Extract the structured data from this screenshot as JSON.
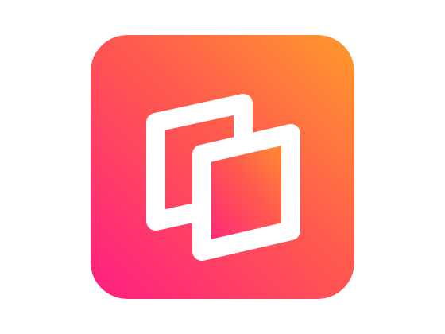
{
  "app_icon": {
    "icon": "overlapping-squares-icon",
    "gradient": {
      "start": "#FF1E82",
      "mid": "#FF5A4E",
      "end": "#FF9A2A"
    },
    "glyph_color": "#FFFFFF"
  }
}
